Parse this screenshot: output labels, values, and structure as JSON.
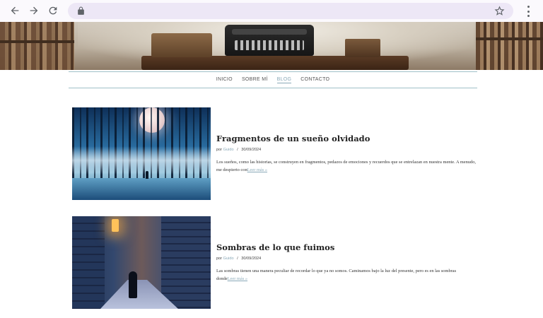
{
  "nav": {
    "items": [
      {
        "label": "INICIO",
        "active": false
      },
      {
        "label": "SOBRE MÍ",
        "active": false
      },
      {
        "label": "BLOG",
        "active": true
      },
      {
        "label": "CONTACTO",
        "active": false
      }
    ]
  },
  "posts": [
    {
      "title": "Fragmentos de un sueño olvidado",
      "author_prefix": "por",
      "author": "Guido",
      "separator": "/",
      "date": "30/09/2024",
      "excerpt": "Los sueños, como las historias, se construyen en fragmentos, pedazos de emociones y recuerdos que se entrelazan en nuestra mente. A menudo, me despierto con",
      "read_more": "Leer más »"
    },
    {
      "title": "Sombras de lo que fuimos",
      "author_prefix": "por",
      "author": "Guido",
      "separator": "/",
      "date": "30/09/2024",
      "excerpt": "Las sombras tienen una manera peculiar de recordar lo que ya no somos. Caminamos bajo la luz del presente, pero es en las sombras donde",
      "read_more": "Leer más »"
    }
  ],
  "icons": {
    "back": "arrow-left-icon",
    "forward": "arrow-right-icon",
    "reload": "reload-icon",
    "lock": "lock-icon",
    "bookmark": "star-icon",
    "menu": "kebab-menu-icon"
  },
  "colors": {
    "accent": "#8aa9b8",
    "nav_border": "#9fc0c8",
    "address_bar": "#ede7f6"
  }
}
